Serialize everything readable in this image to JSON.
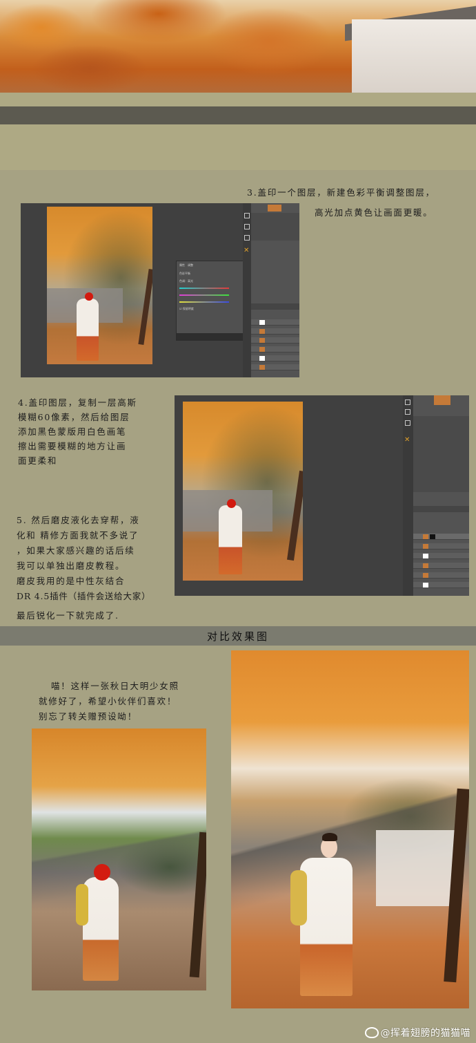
{
  "step3": {
    "line1": "3.盖印一个图层，新建色彩平衡调整图层，",
    "line2": "高光加点黄色让画面更暖。"
  },
  "step4": {
    "lines": [
      "4.盖印图层，复制一层高斯",
      "模糊60像素，然后给图层",
      "添加黑色蒙版用白色画笔",
      "擦出需要模糊的地方让画",
      "面更柔和"
    ]
  },
  "step5": {
    "lines": [
      "5. 然后磨皮液化去穿帮，液",
      "化和 精修方面我就不多说了",
      "，如果大家感兴趣的话后续",
      "我可以单独出磨皮教程。",
      "    磨皮我用的是中性灰结合",
      "DR 4.5插件（插件会送给大家）",
      "最后锐化一下就完成了."
    ]
  },
  "compare": {
    "title": "对比效果图"
  },
  "closing": {
    "lines": [
      "喵！这样一张秋日大明少女照",
      "就修好了，希望小伙伴们喜欢！",
      "别忘了转关赠预设呦！"
    ]
  },
  "watermark": {
    "text": "@挥着翅膀的猫猫喵"
  },
  "colors": {
    "background": "#a6a283",
    "ps_canvas": "#404040",
    "ps_panel": "#535353",
    "compare_bar": "#7b7b6f"
  }
}
